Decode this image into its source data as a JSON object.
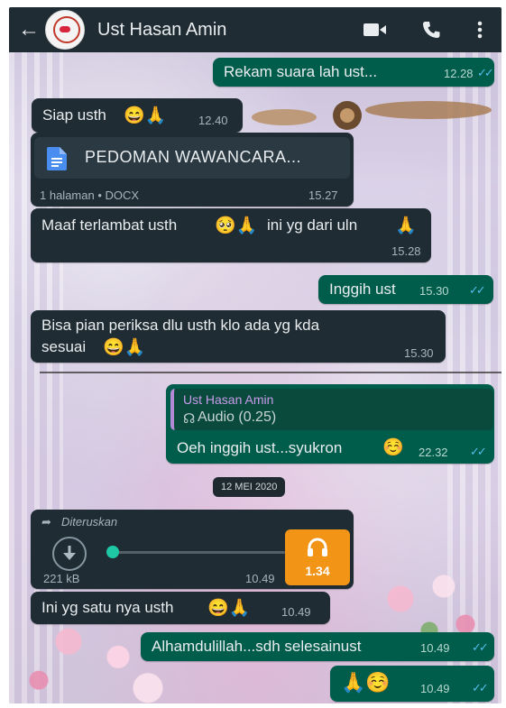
{
  "header": {
    "contact_name": "Ust Hasan Amin",
    "icons": [
      "back-arrow-icon",
      "video-call-icon",
      "voice-call-icon",
      "more-options-icon"
    ]
  },
  "colors": {
    "header_bg": "#1f2c33",
    "incoming_bubble": "#1f2c34",
    "outgoing_bubble": "#005c4b",
    "read_ticks": "#53bdeb",
    "audio_accent": "#f29416",
    "audio_progress": "#1fc8a5"
  },
  "messages": {
    "m1": {
      "text": "Rekam suara lah ust...",
      "time": "12.28"
    },
    "m2": {
      "text": "Siap usth",
      "emoji": "😄🙏",
      "time": "12.40"
    },
    "m3": {
      "doc_name": "PEDOMAN WAWANCARA...",
      "doc_meta": "1 halaman • DOCX",
      "time": "15.27"
    },
    "m4": {
      "text_a": "Maaf terlambat usth",
      "emoji_a": "🥺🙏",
      "text_b": "ini yg dari uln",
      "emoji_b": "🙏",
      "time": "15.28"
    },
    "m5": {
      "text": "Inggih ust",
      "time": "15.30"
    },
    "m6": {
      "line1": "Bisa pian periksa dlu usth klo ada yg kda",
      "line2": "sesuai",
      "emoji": "😄🙏",
      "time": "15.30"
    },
    "m7": {
      "quote_author": "Ust Hasan Amin",
      "quote_text": "Audio (0.25)",
      "text": "Oeh inggih ust...syukron",
      "emoji": "☺️",
      "time": "22.32"
    },
    "date_separator": "12 MEI 2020",
    "m8": {
      "forwarded": "Diteruskan",
      "size": "221 kB",
      "time": "10.49",
      "duration": "1.34",
      "progress": 0
    },
    "m9": {
      "text": "Ini yg satu nya usth",
      "emoji": "😄🙏",
      "time": "10.49"
    },
    "m10": {
      "text": "Alhamdulillah...sdh selesainust",
      "time": "10.49"
    },
    "m11": {
      "emoji": "🙏☺️",
      "time": "10.49"
    }
  }
}
